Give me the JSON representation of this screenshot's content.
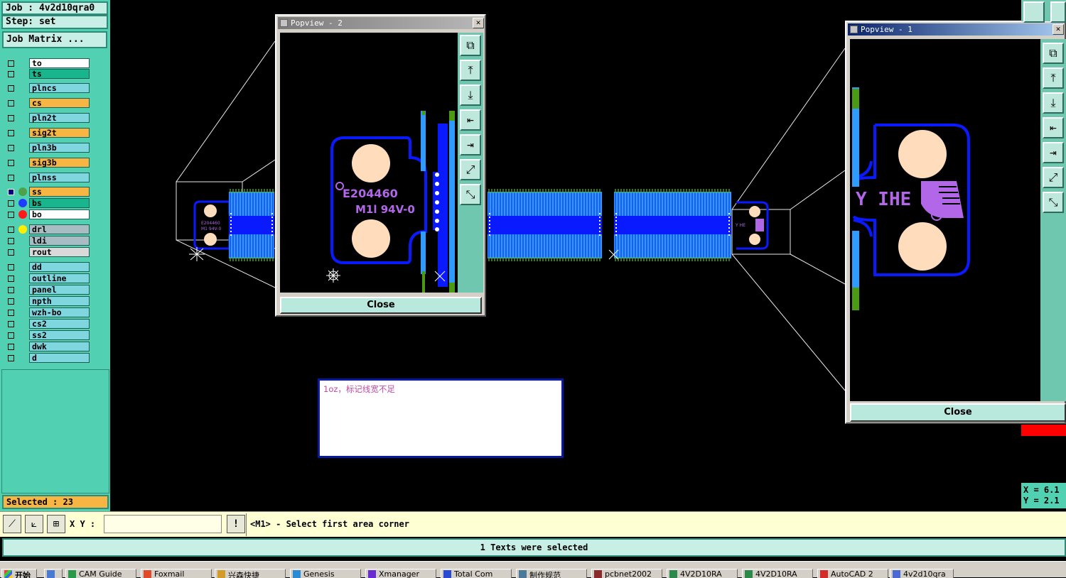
{
  "job_label": "Job : 4v2d10qra0",
  "step_label": "Step: set",
  "job_matrix_button": "Job Matrix ...",
  "layers": [
    {
      "name": "to",
      "color": "#ffffff",
      "checked": false,
      "dot": ""
    },
    {
      "name": "ts",
      "color": "#19b58d",
      "checked": false,
      "dot": ""
    },
    {
      "name": "plncs",
      "color": "#7fd6df",
      "checked": false,
      "dot": ""
    },
    {
      "name": "cs",
      "color": "#f7b543",
      "checked": false,
      "dot": ""
    },
    {
      "name": "pln2t",
      "color": "#7fd6df",
      "checked": false,
      "dot": ""
    },
    {
      "name": "sig2t",
      "color": "#f7b543",
      "checked": false,
      "dot": ""
    },
    {
      "name": "pln3b",
      "color": "#7fd6df",
      "checked": false,
      "dot": ""
    },
    {
      "name": "sig3b",
      "color": "#f7b543",
      "checked": false,
      "dot": ""
    },
    {
      "name": "plnss",
      "color": "#7fd6df",
      "checked": false,
      "dot": ""
    },
    {
      "name": "ss",
      "color": "#f7b543",
      "checked": true,
      "dot": "#4aa34a"
    },
    {
      "name": "bs",
      "color": "#19b58d",
      "checked": false,
      "dot": "#1e3cff"
    },
    {
      "name": "bo",
      "color": "#ffffff",
      "checked": false,
      "dot": "#ff1a1a"
    },
    {
      "name": "drl",
      "color": "#a8bcc4",
      "checked": false,
      "dot": "#ffee00"
    },
    {
      "name": "ldi",
      "color": "#a8bcc4",
      "checked": false,
      "dot": ""
    },
    {
      "name": "rout",
      "color": "#d9d9d9",
      "checked": false,
      "dot": ""
    },
    {
      "name": "dd",
      "color": "#7fd6df",
      "checked": false,
      "dot": ""
    },
    {
      "name": "outline",
      "color": "#7fd6df",
      "checked": false,
      "dot": ""
    },
    {
      "name": "panel",
      "color": "#7fd6df",
      "checked": false,
      "dot": ""
    },
    {
      "name": "npth",
      "color": "#7fd6df",
      "checked": false,
      "dot": ""
    },
    {
      "name": "wzh-bo",
      "color": "#7fd6df",
      "checked": false,
      "dot": ""
    },
    {
      "name": "cs2",
      "color": "#7fd6df",
      "checked": false,
      "dot": ""
    },
    {
      "name": "ss2",
      "color": "#7fd6df",
      "checked": false,
      "dot": ""
    },
    {
      "name": "dwk",
      "color": "#7fd6df",
      "checked": false,
      "dot": ""
    },
    {
      "name": "d",
      "color": "#7fd6df",
      "checked": false,
      "dot": ""
    }
  ],
  "selected_label": "Selected : 23",
  "popview2": {
    "title": "Popview - 2",
    "close_label": "Close",
    "marking_top": "E204460",
    "marking_bottom": "M1l 94V-0"
  },
  "popview1": {
    "title": "Popview - 1",
    "close_label": "Close",
    "marking": "Y IHE"
  },
  "note_text": "1oz，标记线宽不足",
  "coords": {
    "x": "X = 6.1",
    "y": "Y = 2.1"
  },
  "xy_label": "X Y :",
  "xy_value": "",
  "prompt": "<M1> - Select first area corner",
  "status": "1 Texts were selected",
  "taskbar": {
    "start": "开始",
    "tasks": [
      "CAM Guide",
      "Foxmail",
      "兴森快捷",
      "Genesis",
      "Xmanager",
      "Total Com",
      "制作规范",
      "pcbnet2002",
      "4V2D10RA",
      "4V2D10RA",
      "AutoCAD 2",
      "4v2d10qra"
    ]
  },
  "colors": {
    "panel": "#52d1b2",
    "pad": "#ffdcbc",
    "copper": "#2f9bff",
    "trace": "#0a1aff",
    "purple": "#b266e8",
    "green": "#4b9a14"
  }
}
